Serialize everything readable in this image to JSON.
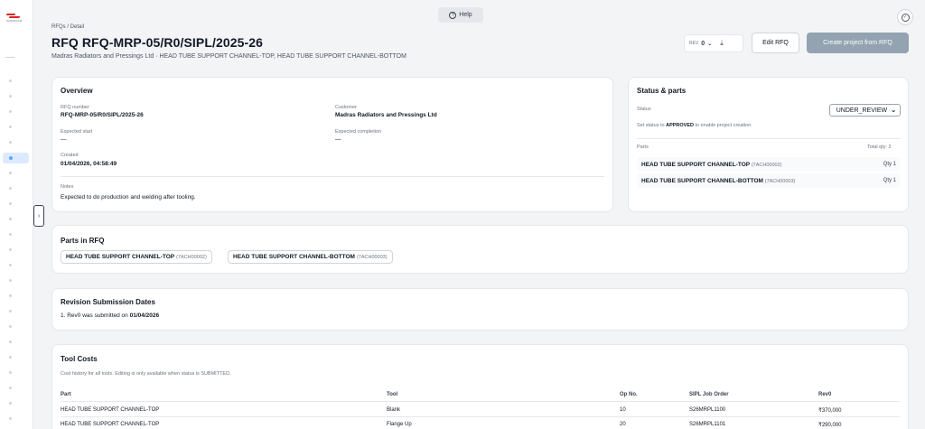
{
  "header": {
    "help_label": "Help",
    "breadcrumb": "RFQs / Detail",
    "title": "RFQ RFQ-MRP-05/R0/SIPL/2025-26",
    "subtitle": "Madras Radiators and Pressings Ltd · HEAD TUBE SUPPORT CHANNEL-TOP, HEAD TUBE SUPPORT CHANNEL-BOTTOM",
    "rev_label": "REV",
    "rev_value": "0",
    "edit_label": "Edit RFQ",
    "create_label": "Create project from RFQ"
  },
  "overview": {
    "title": "Overview",
    "rfq_number_label": "RFQ number",
    "rfq_number": "RFQ-MRP-05/R0/SIPL/2025-26",
    "customer_label": "Customer",
    "customer": "Madras Radiators and Pressings Ltd",
    "expected_start_label": "Expected start",
    "expected_start": "—",
    "expected_completion_label": "Expected completion",
    "expected_completion": "—",
    "created_label": "Created",
    "created": "01/04/2026, 04:58:49",
    "notes_label": "Notes",
    "notes": "Expected to do production and welding after tooling."
  },
  "status_parts": {
    "title": "Status & parts",
    "status_label": "Status",
    "status_value": "UNDER_REVIEW",
    "hint_prefix": "Set status to ",
    "hint_strong": "APPROVED",
    "hint_suffix": " to enable project creation.",
    "parts_label": "Parts",
    "total_qty": "Total qty: 2",
    "parts": [
      {
        "name": "HEAD TUBE SUPPORT CHANNEL-TOP",
        "code": "(7ACH00002)",
        "qty": "Qty 1"
      },
      {
        "name": "HEAD TUBE SUPPORT CHANNEL-BOTTOM",
        "code": "(7ACH00003)",
        "qty": "Qty 1"
      }
    ]
  },
  "parts_in_rfq": {
    "title": "Parts in RFQ",
    "chips": [
      {
        "name": "HEAD TUBE SUPPORT CHANNEL-TOP",
        "code": "(7ACH00002)"
      },
      {
        "name": "HEAD TUBE SUPPORT CHANNEL-BOTTOM",
        "code": "(7ACH00003)"
      }
    ]
  },
  "revisions": {
    "title": "Revision Submission Dates",
    "entry_prefix": "1. Rev0 was submitted on ",
    "entry_date": "01/04/2026"
  },
  "tool_costs": {
    "title": "Tool Costs",
    "note": "Cost history for all tools. Editing is only available when status is SUBMITTED.",
    "columns": [
      "Part",
      "Tool",
      "Op No.",
      "SIPL Job Order",
      "Rev0"
    ],
    "rows": [
      [
        "HEAD TUBE SUPPORT CHANNEL-TOP",
        "Blank",
        "10",
        "S26MRPL1100",
        "₹370,000"
      ],
      [
        "HEAD TUBE SUPPORT CHANNEL-TOP",
        "Flange Up",
        "20",
        "S26MRPL1101",
        "₹290,000"
      ]
    ]
  },
  "colors": {
    "primary_disabled": "#93a3b1",
    "sidebar_active": "#dbeafe",
    "brand_red": "#dc2626"
  },
  "icons": [
    "help-icon",
    "check-circle-icon",
    "chevron-down-icon",
    "download-icon",
    "collapse-sidebar-icon"
  ]
}
